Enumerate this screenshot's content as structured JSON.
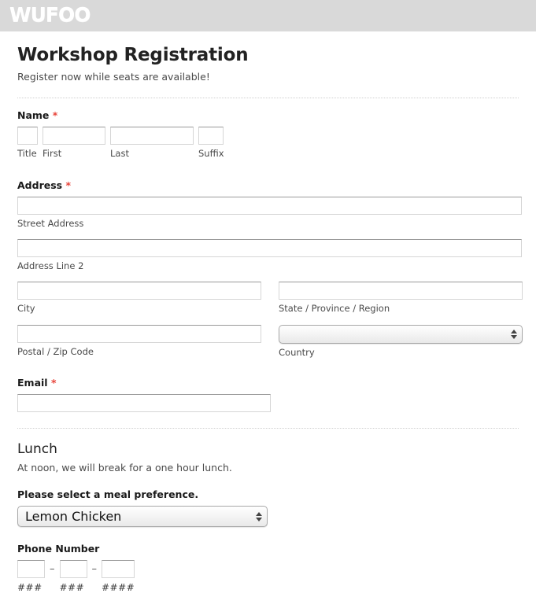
{
  "header": {
    "logo_text": "WUFOO",
    "background_color": "#d9d9d9"
  },
  "form": {
    "title": "Workshop Registration",
    "subtitle": "Register now while seats are available!",
    "required_marker": "*",
    "required_color": "#e8443a"
  },
  "name_field": {
    "label": "Name",
    "title": {
      "value": "",
      "sub_label": "Title"
    },
    "first": {
      "value": "",
      "sub_label": "First"
    },
    "last": {
      "value": "",
      "sub_label": "Last"
    },
    "suffix": {
      "value": "",
      "sub_label": "Suffix"
    }
  },
  "address_field": {
    "label": "Address",
    "street": {
      "value": "",
      "sub_label": "Street Address"
    },
    "line2": {
      "value": "",
      "sub_label": "Address Line 2"
    },
    "city": {
      "value": "",
      "sub_label": "City"
    },
    "state": {
      "value": "",
      "sub_label": "State / Province / Region"
    },
    "postal": {
      "value": "",
      "sub_label": "Postal / Zip Code"
    },
    "country": {
      "value": "",
      "sub_label": "Country"
    }
  },
  "email_field": {
    "label": "Email",
    "value": ""
  },
  "lunch_section": {
    "title": "Lunch",
    "description": "At noon, we will break for a one hour lunch.",
    "meal_label": "Please select a meal preference.",
    "meal_value": "Lemon Chicken"
  },
  "phone_field": {
    "label": "Phone Number",
    "area": {
      "value": "",
      "mask": "###"
    },
    "prefix": {
      "value": "",
      "mask": "###"
    },
    "line": {
      "value": "",
      "mask": "####"
    },
    "separator": "–"
  }
}
